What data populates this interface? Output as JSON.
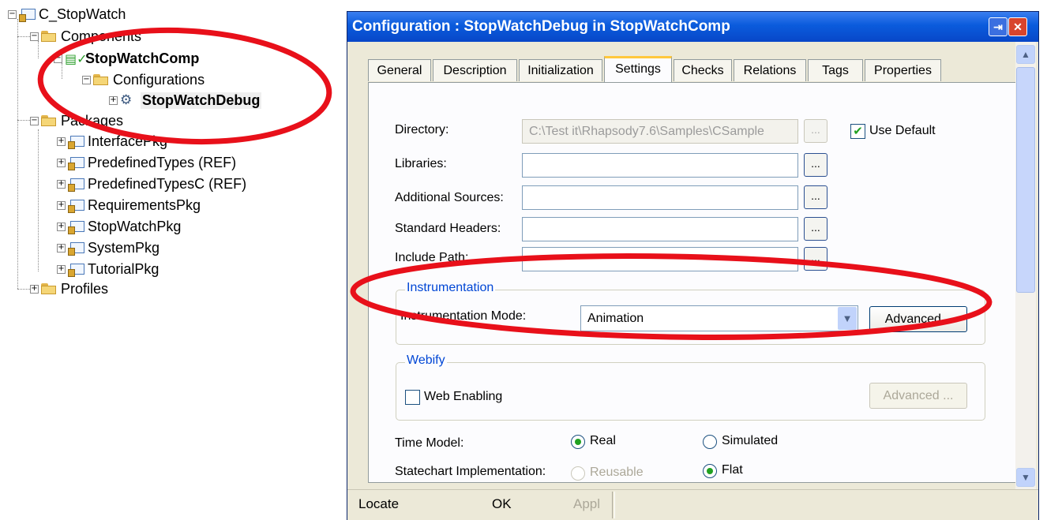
{
  "tree": {
    "root": "C_StopWatch",
    "components": "Components",
    "comp": "StopWatchComp",
    "configurations": "Configurations",
    "config": "StopWatchDebug",
    "packages": "Packages",
    "pkgs": [
      "InterfacePkg",
      "PredefinedTypes (REF)",
      "PredefinedTypesC (REF)",
      "RequirementsPkg",
      "StopWatchPkg",
      "SystemPkg",
      "TutorialPkg"
    ],
    "profiles": "Profiles"
  },
  "dialog": {
    "title": "Configuration : StopWatchDebug in StopWatchComp",
    "tabs": [
      "General",
      "Description",
      "Initialization",
      "Settings",
      "Checks",
      "Relations",
      "Tags",
      "Properties"
    ],
    "active_tab": "Settings",
    "settings": {
      "directory_label": "Directory:",
      "directory_value": "C:\\Test it\\Rhapsody7.6\\Samples\\CSample",
      "use_default_label": "Use Default",
      "use_default_checked": true,
      "libraries_label": "Libraries:",
      "additional_sources_label": "Additional Sources:",
      "standard_headers_label": "Standard Headers:",
      "include_path_label": "Include Path:",
      "browse_label": "...",
      "instrumentation_group": "Instrumentation",
      "instrumentation_mode_label": "Instrumentation Mode:",
      "instrumentation_mode_value": "Animation",
      "advanced_label": "Advanced...",
      "webify_group": "Webify",
      "web_enabling_label": "Web Enabling",
      "webify_advanced_label": "Advanced ...",
      "time_model_label": "Time Model:",
      "time_model_options": [
        "Real",
        "Simulated"
      ],
      "time_model_selected": "Real",
      "statechart_label": "Statechart Implementation:",
      "statechart_options": [
        "Reusable",
        "Flat"
      ],
      "statechart_selected": "Flat"
    },
    "footer": {
      "locate": "Locate",
      "ok": "OK",
      "apply": "Appl"
    }
  },
  "colors": {
    "annotation": "#e8101a",
    "titlebar": "#0a5bdc",
    "group_title": "#0046d5",
    "check_mark": "#21a121"
  }
}
